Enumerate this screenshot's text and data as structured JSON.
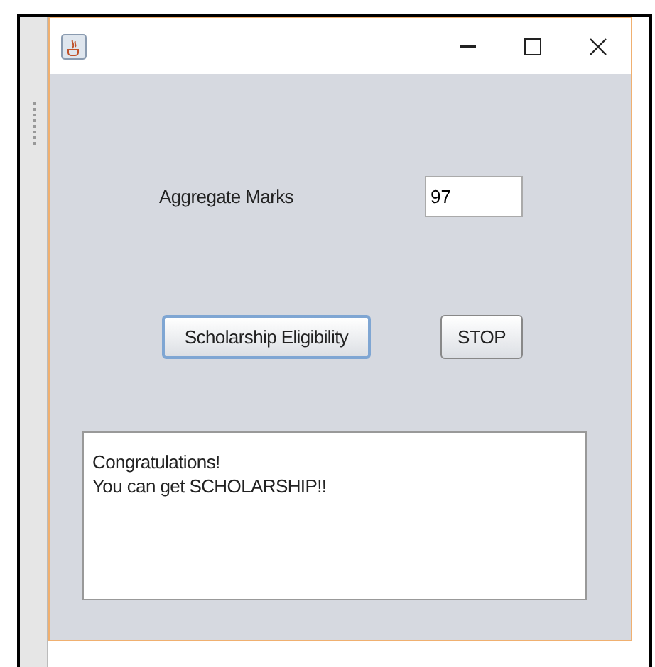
{
  "form": {
    "marks_label": "Aggregate Marks",
    "marks_value": "97"
  },
  "buttons": [
    {
      "label": "Scholarship Eligibility",
      "focused": true
    },
    {
      "label": "STOP",
      "focused": false
    }
  ],
  "output": {
    "lines": [
      "Congratulations!",
      "You can get SCHOLARSHIP!!"
    ]
  }
}
